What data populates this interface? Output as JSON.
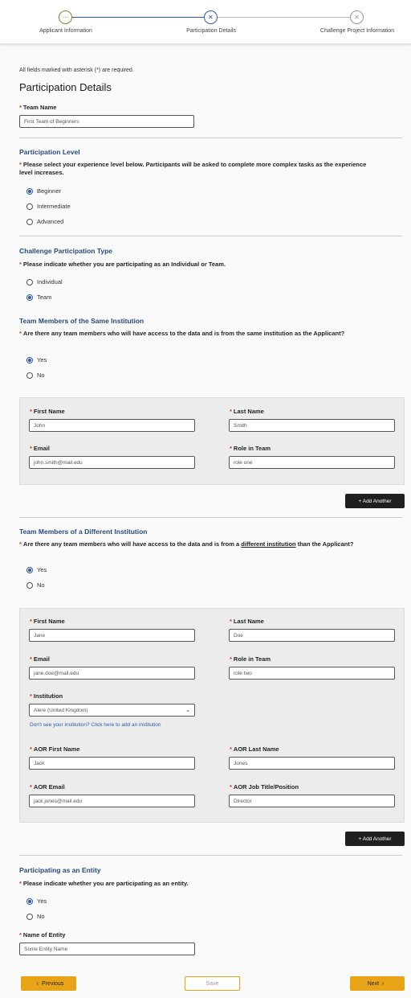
{
  "stepper": {
    "steps": [
      {
        "label": "Applicant Information",
        "icon": "···"
      },
      {
        "label": "Participation Details",
        "icon": "✕"
      },
      {
        "label": "Challenge Project Information",
        "icon": "✕"
      }
    ],
    "colors": {
      "done": "#7a8a3a",
      "active": "#2d5aa8",
      "pending": "#999999"
    }
  },
  "required_note": "All fields marked with asterisk (*) are required.",
  "page_title": "Participation Details",
  "team_name": {
    "label": "Team Name",
    "value": "First Team of Beginners"
  },
  "participation_level": {
    "title": "Participation Level",
    "question": "Please select your experience level below. Participants will be asked to complete more complex tasks as the experience level increases.",
    "options": [
      "Beginner",
      "Intermediate",
      "Advanced"
    ],
    "selected": "Beginner"
  },
  "participation_type": {
    "title": "Challenge Participation Type",
    "question": "Please indicate whether you are participating as an Individual or Team.",
    "options": [
      "Individual",
      "Team"
    ],
    "selected": "Team"
  },
  "same_institution": {
    "title": "Team Members of the Same Institution",
    "question": "Are there any team members who will have access to the data and is from the same institution as the Applicant?",
    "options": [
      "Yes",
      "No"
    ],
    "selected": "Yes",
    "member": {
      "first_name_label": "First Name",
      "first_name": "John",
      "last_name_label": "Last Name",
      "last_name": "Smith",
      "email_label": "Email",
      "email": "john.smith@mail.edu",
      "role_label": "Role in Team",
      "role": "role one"
    },
    "add_button": "+ Add Another"
  },
  "diff_institution": {
    "title": "Team Members of a Different Institution",
    "question_pre": "Are there any team members who will have access to the data and is from a ",
    "question_link": "different institution",
    "question_post": " than the Applicant?",
    "options": [
      "Yes",
      "No"
    ],
    "selected": "Yes",
    "member": {
      "first_name_label": "First Name",
      "first_name": "Jane",
      "last_name_label": "Last Name",
      "last_name": "Doe",
      "email_label": "Email",
      "email": "jane.doe@mail.edu",
      "role_label": "Role in Team",
      "role": "role two",
      "institution_label": "Institution",
      "institution": "Alere (United Kingdom)",
      "institution_link": "Don't see your institution? Click here to add an institution",
      "aor_first_label": "AOR First Name",
      "aor_first": "Jack",
      "aor_last_label": "AOR Last Name",
      "aor_last": "Jones",
      "aor_email_label": "AOR Email",
      "aor_email": "jack.jones@mail.edu",
      "aor_title_label": "AOR Job Title/Position",
      "aor_title": "Director"
    },
    "add_button": "+ Add Another"
  },
  "entity": {
    "title": "Participating as an Entity",
    "question": "Please indicate whether you are participating as an entity.",
    "options": [
      "Yes",
      "No"
    ],
    "selected": "Yes",
    "name_label": "Name of Entity",
    "name_value": "Some Entity Name"
  },
  "footer": {
    "previous": "Previous",
    "save": "Save",
    "next": "Next"
  }
}
